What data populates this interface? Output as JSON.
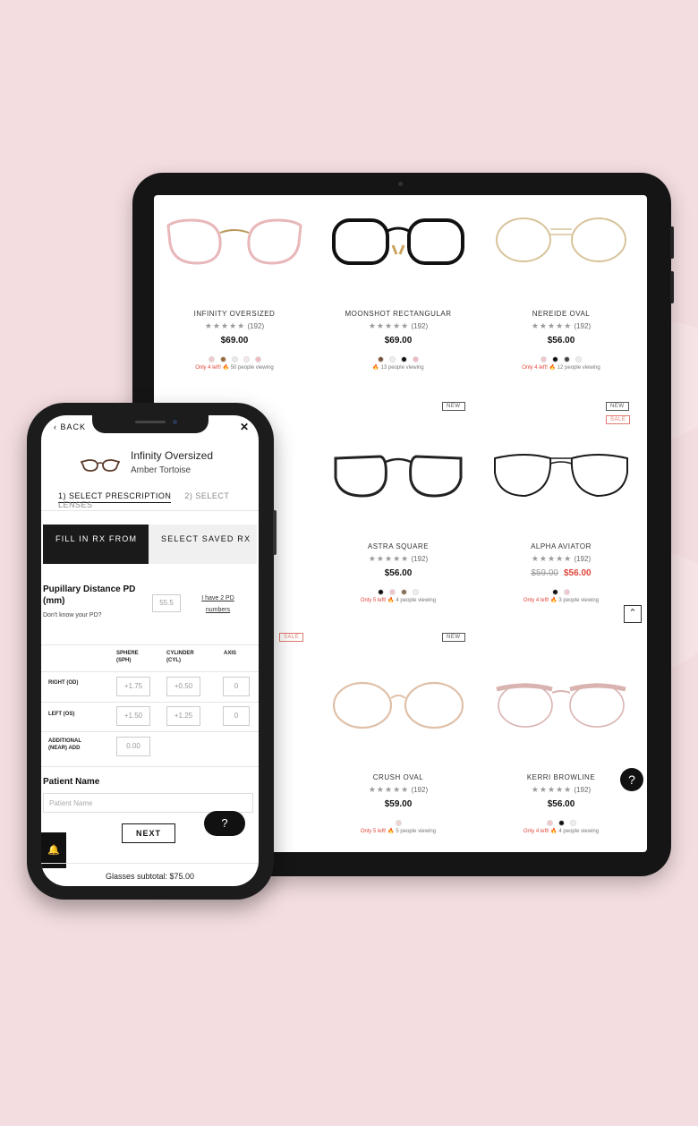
{
  "tablet": {
    "products": [
      {
        "name": "INFINITY OVERSIZED",
        "stars": "★★★★★",
        "reviews": "(192)",
        "price": "$69.00",
        "old_price": "",
        "viewing_only": "Only 4 left!",
        "viewing_text": "🔥 50 people viewing",
        "swatches": [
          "#f1c8cc",
          "#9a6a3a",
          "#eaeaea",
          "#f5e8e8",
          "#f4b9c0"
        ],
        "frame": "#e8b7b9"
      },
      {
        "name": "MOONSHOT RECTANGULAR",
        "stars": "★★★★★",
        "reviews": "(192)",
        "price": "$69.00",
        "old_price": "",
        "viewing_only": "",
        "viewing_text": "🔥 13 people viewing",
        "swatches": [
          "#7a5238",
          "#eeeeee",
          "#111111",
          "#f1b8c0"
        ],
        "frame": "#111111"
      },
      {
        "name": "NEREIDE OVAL",
        "stars": "★★★★★",
        "reviews": "(192)",
        "price": "$56.00",
        "old_price": "",
        "viewing_only": "Only 4 left!",
        "viewing_text": "🔥 12 people viewing",
        "swatches": [
          "#f4c5cb",
          "#111111",
          "#444444",
          "#eeeeee"
        ],
        "frame": "#d7c39a"
      },
      {
        "name": "ASTRA SQUARE",
        "stars": "★★★★★",
        "reviews": "(192)",
        "price": "$56.00",
        "old_price": "",
        "viewing_only": "Only 5 left!",
        "viewing_text": "🔥 4 people viewing",
        "swatches": [
          "#111111",
          "#f1c5cb",
          "#8a6a50",
          "#eeeeee"
        ],
        "frame": "#222222"
      },
      {
        "name": "ALPHA AVIATOR",
        "stars": "★★★★★",
        "reviews": "(192)",
        "price": "$56.00",
        "old_price": "$59.00",
        "viewing_only": "Only 4 left!",
        "viewing_text": "🔥 3 people viewing",
        "swatches": [
          "#111111",
          "#f4c5cb"
        ],
        "frame": "#1a1a1a"
      },
      {
        "name": "CRUSH OVAL",
        "stars": "★★★★★",
        "reviews": "(192)",
        "price": "$59.00",
        "old_price": "",
        "viewing_only": "Only 5 left!",
        "viewing_text": "🔥 5 people viewing",
        "swatches": [
          "#f1d2d2"
        ],
        "frame": "#e0c0a8"
      },
      {
        "name": "KERRI BROWLINE",
        "stars": "★★★★★",
        "reviews": "(192)",
        "price": "$56.00",
        "old_price": "",
        "viewing_only": "Only 4 left!",
        "viewing_text": "🔥 4 people viewing",
        "swatches": [
          "#f4c5cb",
          "#111111",
          "#eeeeee"
        ],
        "frame": "#d9b3b0"
      }
    ],
    "badges": {
      "new": "NEW",
      "sale": "SALE"
    }
  },
  "phone": {
    "back_label": "BACK",
    "close_label": "✕",
    "product_title": "Infinity Oversized",
    "product_color": "Amber Tortoise",
    "step1": "1) SELECT PRESCRIPTION",
    "step2": "2) SELECT LENSES",
    "tab_fill": "FILL IN RX FROM",
    "tab_saved": "SELECT SAVED RX",
    "pd_label": "Pupillary Distance PD (mm)",
    "pd_help": "Don't know your PD?",
    "pd_value": "55.5",
    "pd_link": "I have 2 PD numbers",
    "rx_headers": {
      "sphere": "SPHERE (SPH)",
      "cylinder": "CYLINDER (CYL)",
      "axis": "AXIS"
    },
    "rx_rows": {
      "right": {
        "label": "RIGHT (OD)",
        "sphere": "+1.75",
        "cylinder": "+0.50",
        "axis": "0"
      },
      "left": {
        "label": "LEFT (OS)",
        "sphere": "+1.50",
        "cylinder": "+1.25",
        "axis": "0"
      },
      "add": {
        "label": "ADDITIONAL (NEAR) ADD",
        "value": "0.00"
      }
    },
    "patient_label": "Patient Name",
    "patient_placeholder": "Patient Name",
    "next_label": "NEXT",
    "subtotal": "Glasses subtotal: $75.00"
  }
}
